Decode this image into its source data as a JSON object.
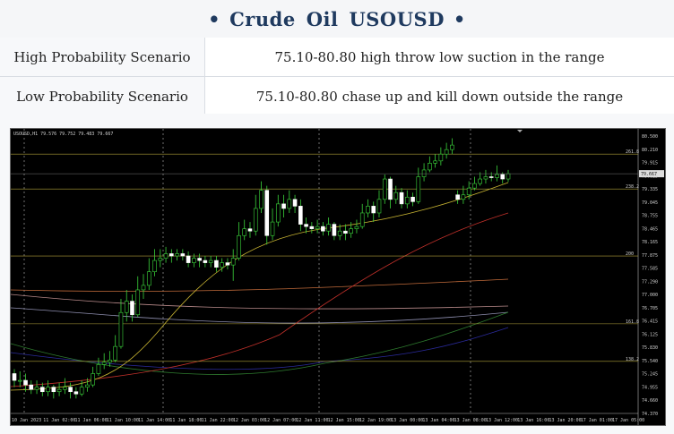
{
  "header": {
    "dot_left": "•",
    "word1": "Crude",
    "word2": "Oil",
    "word3": "USOUSD",
    "dot_right": "•"
  },
  "scenarios": [
    {
      "label": "High Probability Scenario",
      "text": "75.10-80.80 high throw low suction in the range"
    },
    {
      "label": "Low Probability Scenario",
      "text": "75.10-80.80 chase up and kill down outside the range"
    }
  ],
  "chart_data": {
    "type": "candlestick",
    "symbol_info": "USOUSD,H1  79.576 79.752 79.483 79.667",
    "y_ticks": [
      "80.500",
      "80.210",
      "79.915",
      "79.625",
      "79.335",
      "79.045",
      "78.755",
      "78.465",
      "78.165",
      "77.875",
      "77.585",
      "77.290",
      "77.000",
      "76.705",
      "76.415",
      "76.125",
      "75.830",
      "75.540",
      "75.245",
      "74.955",
      "74.660",
      "74.370"
    ],
    "ylim": [
      74.37,
      80.5
    ],
    "price_label": "79.667",
    "x_ticks": [
      "10 Jan 2023",
      "11 Jan 02:00",
      "11 Jan 06:00",
      "11 Jan 10:00",
      "11 Jan 14:00",
      "11 Jan 18:00",
      "11 Jan 22:00",
      "12 Jan 03:00",
      "12 Jan 07:00",
      "12 Jan 11:00",
      "12 Jan 15:00",
      "12 Jan 19:00",
      "13 Jan 00:00",
      "13 Jan 04:00",
      "13 Jan 08:00",
      "13 Jan 12:00",
      "13 Jan 16:00",
      "13 Jan 20:00",
      "17 Jan 01:00",
      "17 Jan 05:00"
    ],
    "fib_levels": [
      {
        "label": "261.8",
        "value": 80.1
      },
      {
        "label": "238.2",
        "value": 79.33
      },
      {
        "label": "200",
        "value": 77.85
      },
      {
        "label": "161.8",
        "value": 76.35
      },
      {
        "label": "138.2",
        "value": 75.52
      }
    ],
    "candles": [
      [
        75.25,
        75.1,
        75.35,
        74.95
      ],
      [
        75.1,
        75.1,
        75.3,
        74.95
      ],
      [
        75.1,
        75.0,
        75.25,
        74.85
      ],
      [
        75.0,
        74.9,
        75.1,
        74.8
      ],
      [
        74.9,
        74.95,
        75.1,
        74.8
      ],
      [
        74.95,
        74.85,
        75.05,
        74.75
      ],
      [
        74.85,
        74.95,
        75.1,
        74.75
      ],
      [
        74.95,
        74.85,
        75.0,
        74.7
      ],
      [
        74.85,
        74.9,
        75.05,
        74.75
      ],
      [
        74.9,
        74.95,
        75.15,
        74.8
      ],
      [
        74.95,
        74.85,
        75.05,
        74.7
      ],
      [
        74.85,
        74.8,
        74.95,
        74.7
      ],
      [
        74.8,
        74.95,
        75.1,
        74.75
      ],
      [
        74.95,
        75.0,
        75.15,
        74.85
      ],
      [
        75.0,
        75.25,
        75.4,
        74.95
      ],
      [
        75.25,
        75.45,
        75.6,
        75.2
      ],
      [
        75.45,
        75.5,
        75.7,
        75.35
      ],
      [
        75.5,
        75.55,
        75.75,
        75.4
      ],
      [
        75.55,
        75.85,
        76.1,
        75.5
      ],
      [
        75.85,
        76.6,
        76.9,
        75.8
      ],
      [
        76.6,
        76.85,
        77.1,
        76.4
      ],
      [
        76.85,
        76.55,
        77.0,
        76.4
      ],
      [
        76.55,
        77.1,
        77.4,
        76.5
      ],
      [
        77.1,
        77.2,
        77.45,
        76.9
      ],
      [
        77.2,
        77.5,
        77.8,
        77.1
      ],
      [
        77.5,
        77.75,
        78.0,
        77.4
      ],
      [
        77.75,
        77.8,
        78.0,
        77.6
      ],
      [
        77.8,
        77.9,
        78.05,
        77.7
      ],
      [
        77.9,
        77.85,
        78.0,
        77.7
      ],
      [
        77.85,
        77.9,
        78.0,
        77.75
      ],
      [
        77.9,
        77.85,
        78.0,
        77.75
      ],
      [
        77.85,
        77.7,
        77.95,
        77.6
      ],
      [
        77.7,
        77.8,
        77.9,
        77.6
      ],
      [
        77.8,
        77.75,
        77.9,
        77.6
      ],
      [
        77.75,
        77.7,
        77.85,
        77.6
      ],
      [
        77.7,
        77.75,
        77.85,
        77.6
      ],
      [
        77.75,
        77.6,
        77.85,
        77.5
      ],
      [
        77.6,
        77.7,
        77.8,
        77.5
      ],
      [
        77.7,
        77.65,
        77.8,
        77.55
      ],
      [
        77.65,
        77.8,
        78.0,
        77.3
      ],
      [
        77.8,
        78.3,
        78.6,
        77.75
      ],
      [
        78.3,
        78.45,
        78.65,
        78.2
      ],
      [
        78.45,
        78.4,
        78.6,
        78.25
      ],
      [
        78.4,
        78.9,
        79.2,
        78.3
      ],
      [
        78.9,
        79.3,
        79.5,
        78.8
      ],
      [
        79.3,
        78.3,
        79.4,
        78.1
      ],
      [
        78.3,
        78.6,
        78.9,
        78.2
      ],
      [
        78.6,
        79.0,
        79.2,
        78.5
      ],
      [
        79.0,
        78.9,
        79.2,
        78.7
      ],
      [
        78.9,
        79.1,
        79.3,
        78.8
      ],
      [
        79.1,
        78.95,
        79.2,
        78.8
      ],
      [
        78.95,
        78.55,
        79.1,
        78.4
      ],
      [
        78.55,
        78.5,
        78.7,
        78.35
      ],
      [
        78.5,
        78.45,
        78.6,
        78.35
      ],
      [
        78.45,
        78.5,
        78.65,
        78.35
      ],
      [
        78.5,
        78.4,
        78.6,
        78.3
      ],
      [
        78.4,
        78.55,
        78.7,
        78.3
      ],
      [
        78.55,
        78.3,
        78.6,
        78.2
      ],
      [
        78.3,
        78.4,
        78.55,
        78.2
      ],
      [
        78.4,
        78.35,
        78.55,
        78.2
      ],
      [
        78.35,
        78.45,
        78.6,
        78.25
      ],
      [
        78.45,
        78.5,
        78.65,
        78.35
      ],
      [
        78.5,
        78.8,
        79.0,
        78.45
      ],
      [
        78.8,
        78.95,
        79.1,
        78.7
      ],
      [
        78.95,
        78.8,
        79.05,
        78.6
      ],
      [
        78.8,
        79.1,
        79.3,
        78.7
      ],
      [
        79.1,
        79.55,
        79.65,
        79.0
      ],
      [
        79.55,
        79.1,
        79.6,
        78.9
      ],
      [
        79.1,
        79.25,
        79.4,
        79.0
      ],
      [
        79.25,
        79.0,
        79.35,
        78.9
      ],
      [
        79.0,
        79.15,
        79.3,
        78.9
      ],
      [
        79.15,
        79.05,
        79.25,
        78.95
      ],
      [
        79.05,
        79.6,
        79.8,
        79.0
      ],
      [
        79.6,
        79.75,
        79.9,
        79.5
      ],
      [
        79.75,
        79.9,
        80.05,
        79.7
      ],
      [
        79.9,
        79.95,
        80.1,
        79.8
      ],
      [
        79.95,
        80.1,
        80.25,
        79.85
      ],
      [
        80.1,
        80.2,
        80.35,
        80.0
      ],
      [
        80.2,
        80.3,
        80.45,
        80.1
      ],
      [
        79.2,
        79.1,
        79.3,
        79.0
      ],
      [
        79.1,
        79.2,
        79.4,
        79.0
      ],
      [
        79.2,
        79.35,
        79.5,
        79.1
      ],
      [
        79.35,
        79.45,
        79.6,
        79.3
      ],
      [
        79.45,
        79.55,
        79.7,
        79.4
      ],
      [
        79.55,
        79.6,
        79.75,
        79.45
      ],
      [
        79.6,
        79.58,
        79.7,
        79.5
      ],
      [
        79.58,
        79.65,
        79.85,
        79.5
      ],
      [
        79.65,
        79.55,
        79.7,
        79.45
      ],
      [
        79.55,
        79.667,
        79.752,
        79.483
      ]
    ],
    "grid": false,
    "legend": "none"
  }
}
